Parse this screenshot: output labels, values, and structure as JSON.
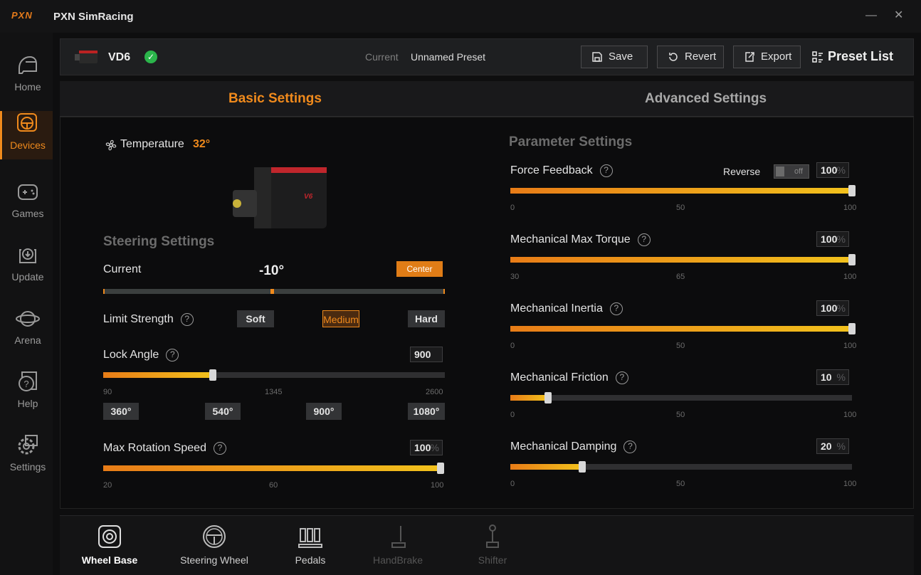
{
  "app": {
    "logo": "PXN",
    "title": "PXN SimRacing",
    "minimize": "—",
    "close": "✕"
  },
  "sidebar": {
    "items": [
      {
        "label": "Home",
        "icon": "helmet-icon"
      },
      {
        "label": "Devices",
        "icon": "steering-wheel-icon",
        "active": true
      },
      {
        "label": "Games",
        "icon": "gamepad-icon"
      },
      {
        "label": "Update",
        "icon": "download-icon"
      },
      {
        "label": "Arena",
        "icon": "planet-icon"
      },
      {
        "label": "Help",
        "icon": "help-icon"
      },
      {
        "label": "Settings",
        "icon": "gear-icon"
      }
    ]
  },
  "device": {
    "name": "VD6",
    "status_icon": "check-icon",
    "status_color": "#2bb54b",
    "current_label": "Current",
    "preset_name": "Unnamed Preset"
  },
  "toolbar": {
    "save": "Save",
    "revert": "Revert",
    "export": "Export",
    "preset_list": "Preset List"
  },
  "tabs": {
    "basic": "Basic Settings",
    "advanced": "Advanced Settings"
  },
  "temperature": {
    "label": "Temperature",
    "value": "32°"
  },
  "steering": {
    "section": "Steering Settings",
    "current_label": "Current",
    "current_value": "-10°",
    "center_button": "Center",
    "limit_strength": {
      "label": "Limit Strength",
      "options": [
        "Soft",
        "Medium",
        "Hard"
      ],
      "selected": "Medium"
    },
    "lock_angle": {
      "label": "Lock Angle",
      "value": "900",
      "min": "90",
      "mid": "1345",
      "max": "2600",
      "presets": [
        "360°",
        "540°",
        "900°",
        "1080°"
      ],
      "level": 0.32
    },
    "max_rotation_speed": {
      "label": "Max Rotation Speed",
      "value": "100",
      "unit": "%",
      "min": "20",
      "mid": "60",
      "max": "100",
      "level": 1.0
    }
  },
  "parameters": {
    "section": "Parameter Settings",
    "reverse_label": "Reverse",
    "reverse_state": "off",
    "items": [
      {
        "label": "Force Feedback",
        "value": "100",
        "unit": "%",
        "min": "0",
        "mid": "50",
        "max": "100",
        "level": 1.0
      },
      {
        "label": "Mechanical Max Torque",
        "value": "100",
        "unit": "%",
        "min": "30",
        "mid": "65",
        "max": "100",
        "level": 1.0
      },
      {
        "label": "Mechanical Inertia",
        "value": "100",
        "unit": "%",
        "min": "0",
        "mid": "50",
        "max": "100",
        "level": 1.0
      },
      {
        "label": "Mechanical Friction",
        "value": "10",
        "unit": "%",
        "min": "0",
        "mid": "50",
        "max": "100",
        "level": 0.11
      },
      {
        "label": "Mechanical Damping",
        "value": "20",
        "unit": "%",
        "min": "0",
        "mid": "50",
        "max": "100",
        "level": 0.21
      }
    ]
  },
  "bottom_tabs": [
    {
      "label": "Wheel Base",
      "icon": "wheel-base-icon",
      "active": true
    },
    {
      "label": "Steering Wheel",
      "icon": "steering-wheel-icon"
    },
    {
      "label": "Pedals",
      "icon": "pedals-icon"
    },
    {
      "label": "HandBrake",
      "icon": "handbrake-icon",
      "disabled": true
    },
    {
      "label": "Shifter",
      "icon": "shifter-icon",
      "disabled": true
    }
  ],
  "colors": {
    "accent": "#f08a1c",
    "accent_end": "#f2c21c",
    "panel": "#1e1f21",
    "background": "#0e0e0f"
  }
}
